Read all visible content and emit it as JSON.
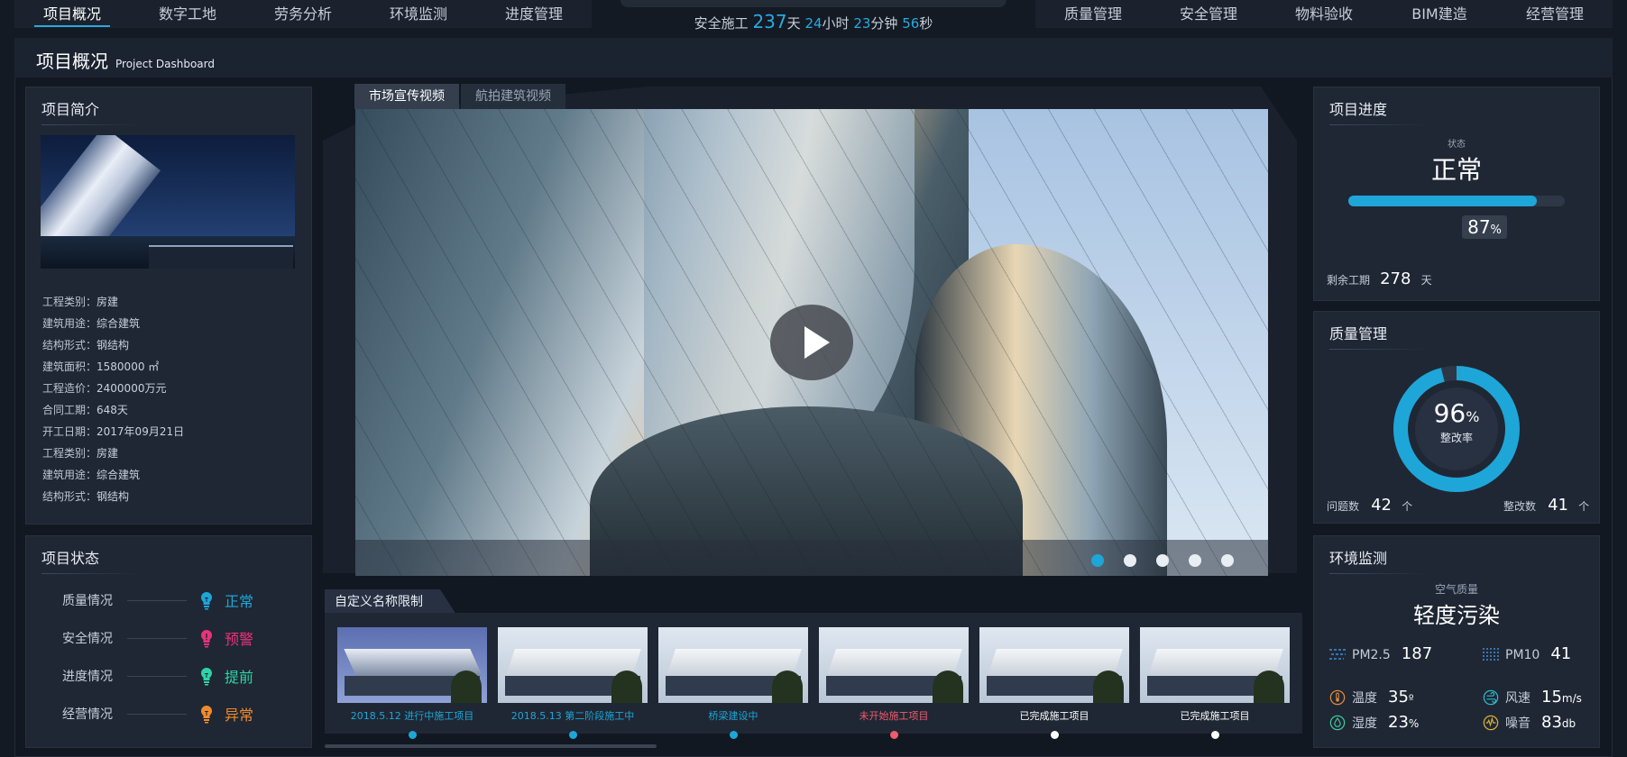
{
  "nav": {
    "left": [
      "项目概况",
      "数字工地",
      "劳务分析",
      "环境监测",
      "进度管理"
    ],
    "right": [
      "质量管理",
      "安全管理",
      "物料验收",
      "BIM建造",
      "经营管理"
    ],
    "active": "项目概况"
  },
  "safety_timer": {
    "prefix": "安全施工",
    "days": "237",
    "days_unit": "天",
    "hours": "24",
    "hours_unit": "小时",
    "minutes": "23",
    "minutes_unit": "分钟",
    "seconds": "56",
    "seconds_unit": "秒"
  },
  "page": {
    "title": "项目概况",
    "subtitle": "Project Dashboard"
  },
  "intro": {
    "title": "项目简介",
    "rows": [
      {
        "k": "工程类别：",
        "v": "房建"
      },
      {
        "k": "建筑用途：",
        "v": "综合建筑"
      },
      {
        "k": "结构形式：",
        "v": "钢结构"
      },
      {
        "k": "建筑面积：",
        "v": "1580000 ㎡"
      },
      {
        "k": "工程造价：",
        "v": "2400000万元"
      },
      {
        "k": "合同工期：",
        "v": "648天"
      },
      {
        "k": "开工日期：",
        "v": "2017年09月21日"
      },
      {
        "k": "工程类别：",
        "v": "房建"
      },
      {
        "k": "建筑用途：",
        "v": "综合建筑"
      },
      {
        "k": "结构形式：",
        "v": "钢结构"
      }
    ]
  },
  "status": {
    "title": "项目状态",
    "rows": [
      {
        "label": "质量情况",
        "value": "正常",
        "color": "#1ea6d8"
      },
      {
        "label": "安全情况",
        "value": "预警",
        "color": "#e8337a"
      },
      {
        "label": "进度情况",
        "value": "提前",
        "color": "#2fd3a6"
      },
      {
        "label": "经营情况",
        "value": "异常",
        "color": "#f08a2a"
      }
    ]
  },
  "video": {
    "tabs": [
      "市场宣传视频",
      "航拍建筑视频"
    ],
    "active_tab": 0,
    "dots": 5,
    "active_dot": 0
  },
  "strip": {
    "title": "自定义名称限制",
    "items": [
      {
        "caption": "2018.5.12 进行中施工项目",
        "color": "#1ea6d8"
      },
      {
        "caption": "2018.5.13 第二阶段施工中",
        "color": "#1ea6d8"
      },
      {
        "caption": "桥梁建设中",
        "color": "#1ea6d8"
      },
      {
        "caption": "未开始施工项目",
        "color": "#ef5b6e"
      },
      {
        "caption": "已完成施工项目",
        "color": "#ffffff"
      },
      {
        "caption": "已完成施工项目",
        "color": "#ffffff"
      }
    ]
  },
  "progress": {
    "title": "项目进度",
    "state_caption": "状态",
    "state": "正常",
    "percent": "87",
    "percent_unit": "%",
    "remaining_label": "剩余工期",
    "remaining_value": "278",
    "remaining_unit": "天"
  },
  "quality": {
    "title": "质量管理",
    "rate": "96",
    "rate_unit": "%",
    "rate_label": "整改率",
    "issues_label": "问题数",
    "issues_value": "42",
    "issues_unit": "个",
    "fixed_label": "整改数",
    "fixed_value": "41",
    "fixed_unit": "个"
  },
  "env": {
    "title": "环境监测",
    "air_caption": "空气质量",
    "air_state": "轻度污染",
    "pm25_label": "PM2.5",
    "pm25_value": "187",
    "pm10_label": "PM10",
    "pm10_value": "41",
    "temp_label": "温度",
    "temp_value": "35",
    "temp_unit": "º",
    "wind_label": "风速",
    "wind_value": "15",
    "wind_unit": "m/s",
    "humid_label": "湿度",
    "humid_value": "23",
    "humid_unit": "%",
    "noise_label": "噪音",
    "noise_value": "83",
    "noise_unit": "db"
  }
}
